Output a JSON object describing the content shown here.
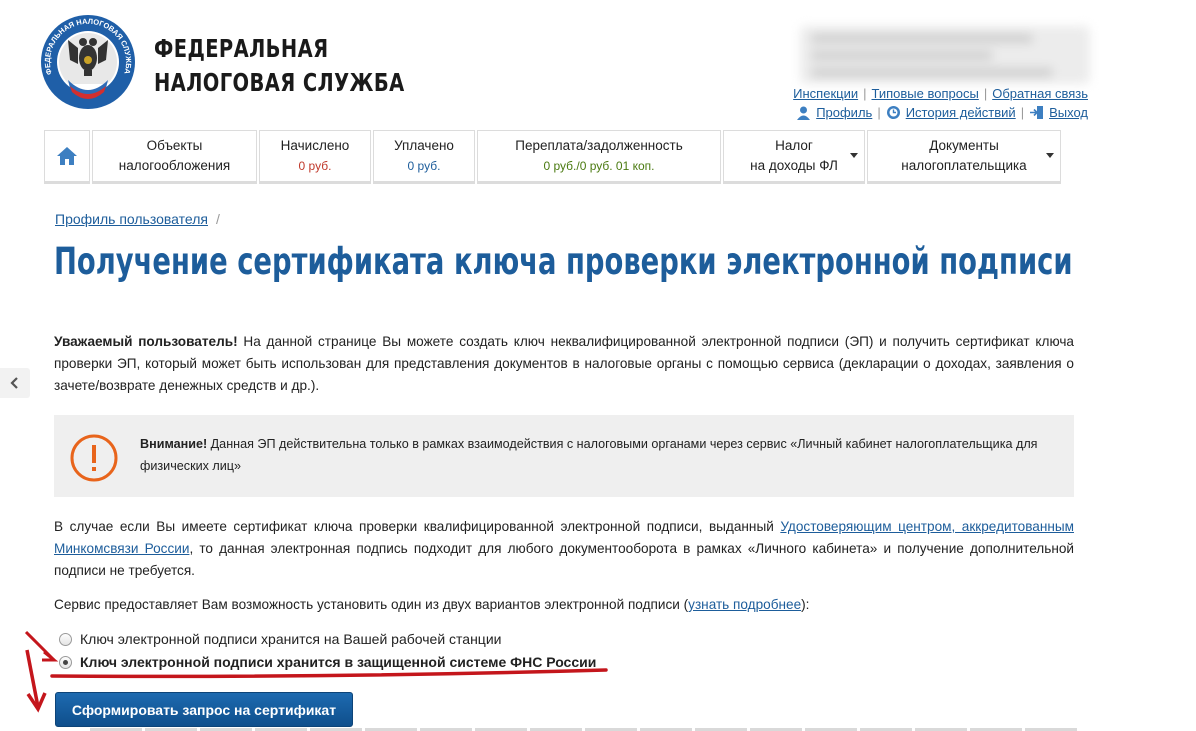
{
  "header": {
    "brand_line1": "ФЕДЕРАЛЬНАЯ",
    "brand_line2": "НАЛОГОВАЯ СЛУЖБА",
    "logo_text": "ФЕДЕРАЛЬНАЯ НАЛОГОВАЯ СЛУЖБА",
    "links_top": [
      "Инспекции",
      "Типовые вопросы",
      "Обратная связь"
    ],
    "profile_label": "Профиль",
    "history_label": "История действий",
    "logout_label": "Выход"
  },
  "nav": {
    "items": [
      {
        "label1": "Объекты",
        "label2": "налогообложения"
      },
      {
        "label1": "Начислено",
        "value": "0 руб."
      },
      {
        "label1": "Уплачено",
        "value": "0 руб."
      },
      {
        "label1": "Переплата/задолженность",
        "value": "0 руб./0 руб. 01 коп."
      },
      {
        "label1": "Налог",
        "label2": "на доходы ФЛ"
      },
      {
        "label1": "Документы",
        "label2": "налогоплательщика"
      }
    ]
  },
  "breadcrumb": {
    "link": "Профиль пользователя",
    "separator": "/"
  },
  "page_title": "Получение сертификата ключа проверки электронной подписи",
  "intro": {
    "bold": "Уважаемый пользователь!",
    "text": " На данной странице Вы можете создать ключ неквалифицированной электронной подписи (ЭП) и получить сертификат ключа проверки ЭП, который может быть использован для представления документов в налоговые органы с помощью сервиса (декларации о доходах, заявления о зачете/возврате денежных средств и др.)."
  },
  "notice": {
    "bold": "Внимание!",
    "text": " Данная ЭП действительна только в рамках взаимодействия с налоговыми органами через сервис «Личный кабинет налогоплательщика для физических лиц»"
  },
  "qualified": {
    "text1": "В случае если Вы имеете сертификат ключа проверки квалифицированной электронной подписи, выданный ",
    "link": "Удостоверяющим центром, аккредитованным Минкомсвязи России",
    "text2": ", то данная электронная подпись подходит для любого документооборота в рамках «Личного кабинета» и получение дополнительной подписи не требуется."
  },
  "service": {
    "text1": "Сервис предоставляет Вам возможность установить один из двух вариантов электронной подписи (",
    "link": "узнать подробнее",
    "text2": "):"
  },
  "options": [
    {
      "label": "Ключ электронной подписи хранится на Вашей рабочей станции",
      "selected": false
    },
    {
      "label": "Ключ электронной подписи хранится в защищенной системе ФНС России",
      "selected": true
    }
  ],
  "submit_label": "Сформировать запрос на сертификат",
  "colors": {
    "brand_blue": "#1d5d9b",
    "alert_orange": "#e8641b",
    "annotation_red": "#c4161c"
  }
}
